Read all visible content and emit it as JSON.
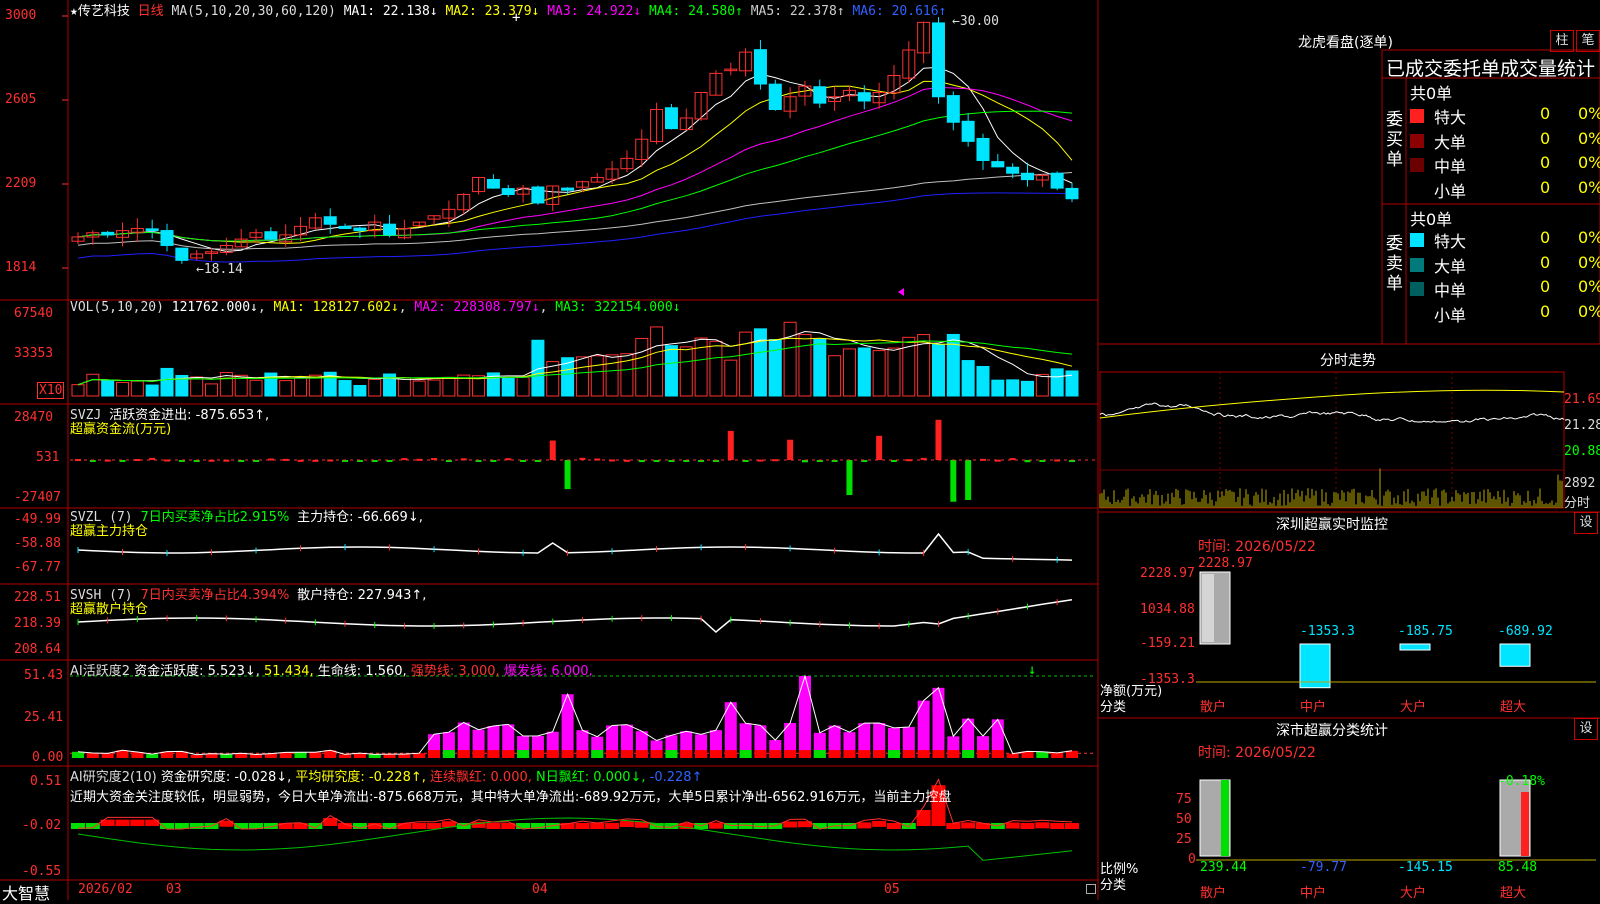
{
  "colors": {
    "up": "#ff3030",
    "down": "#00e5ff",
    "ma1": "#ffffff",
    "ma2": "#ffff00",
    "ma3": "#ff00ff",
    "ma4": "#00ff00",
    "ma5": "#c0c0c0",
    "ma6": "#2020ff",
    "frame": "#b00000"
  },
  "header": {
    "star": "★",
    "name": "传艺科技",
    "period": "日线",
    "ma_def": "MA(5,10,20,30,60,120)",
    "ma1": "MA1: 22.138↓",
    "ma2": "MA2: 23.379↓",
    "ma3": "MA3: 24.922↓",
    "ma4": "MA4: 24.580↑",
    "ma5": "MA5: 22.378↑",
    "ma6": "MA6: 20.616↑"
  },
  "price_axis": [
    "3000",
    "2605",
    "2209",
    "1814"
  ],
  "price_notes": {
    "high": "30.00",
    "low": "18.14"
  },
  "vol_panel": {
    "title": "VOL(5,10,20)",
    "v": "121762.000↓",
    "ma1": "MA1: 128127.602↓",
    "ma2": "MA2: 228308.797↓",
    "ma3": "MA3: 322154.000↓",
    "axis": [
      "67540",
      "33353"
    ],
    "unit": "X10"
  },
  "svzj": {
    "title": "SVZJ",
    "desc": "活跃资金进出: -875.653↑,",
    "sub": "超赢资金流(万元)",
    "axis": [
      "28470",
      "531",
      "-27407"
    ]
  },
  "svzl": {
    "title": "SVZL (7)",
    "desc1": "7日内买卖净占比2.915%",
    "desc2": "主力持仓: -66.669↓,",
    "sub": "超赢主力持仓",
    "axis": [
      "-49.99",
      "-58.88",
      "-67.77"
    ]
  },
  "svsh": {
    "title": "SVSH (7)",
    "desc1": "7日内买卖净占比4.394%",
    "desc2": "散户持仓: 227.943↑,",
    "sub": "超赢散户持仓",
    "axis": [
      "228.51",
      "218.39",
      "208.64"
    ]
  },
  "ai2": {
    "title": "AI活跃度2",
    "d1": "资金活跃度: 5.523↓",
    "d2": "51.434,",
    "d3": "生命线: 1.560,",
    "d4": "强势线: 3.000,",
    "d5": "爆发线: 6.000,",
    "axis": [
      "51.43",
      "25.41",
      "0.00"
    ]
  },
  "ai3": {
    "title": "AI研究度2(10)",
    "d1": "资金研究度: -0.028↓,",
    "d2": "平均研究度: -0.228↑,",
    "d3": "连续飘红: 0.000,",
    "d4": "N日飘红: 0.000↓,",
    "d5": "-0.228↑",
    "text": "近期大资金关注度较低，明显弱势，今日大单净流出:-875.668万元，其中特大单净流出:-689.92万元，大单5日累计净出-6562.916万元，当前主力控盘",
    "axis": [
      "0.51",
      "-0.02",
      "-0.55"
    ]
  },
  "date_axis": {
    "left": "大智慧",
    "labels": [
      "2026/02",
      "03",
      "04",
      "05"
    ]
  },
  "right": {
    "title": "龙虎看盘(逐单)",
    "btn1": "柱",
    "btn2": "笔",
    "subtitle": "已成交委托单成交量统计",
    "buy_label": "委买单",
    "sell_label": "委卖单",
    "buy_total": "共0单",
    "sell_total": "共0单",
    "buy_rows": [
      {
        "name": "特大",
        "n": "0",
        "p": "0%",
        "c": "#ff2020"
      },
      {
        "name": "大单",
        "n": "0",
        "p": "0%",
        "c": "#8b0000"
      },
      {
        "name": "中单",
        "n": "0",
        "p": "0%",
        "c": "#6b0000"
      },
      {
        "name": "小单",
        "n": "0",
        "p": "0%",
        "c": ""
      }
    ],
    "sell_rows": [
      {
        "name": "特大",
        "n": "0",
        "p": "0%",
        "c": "#00e5ff"
      },
      {
        "name": "大单",
        "n": "0",
        "p": "0%",
        "c": "#007a7a"
      },
      {
        "name": "中单",
        "n": "0",
        "p": "0%",
        "c": "#006060"
      },
      {
        "name": "小单",
        "n": "0",
        "p": "0%",
        "c": ""
      }
    ]
  },
  "intraday": {
    "title": "分时走势",
    "axis": [
      "21.69",
      "21.28",
      "20.88"
    ],
    "vol": "2892",
    "unit": "分时"
  },
  "monitor": {
    "title": "深圳超赢实时监控",
    "btn": "设",
    "time": "时间: 2026/05/22",
    "axis": [
      "2228.97",
      "1034.88",
      "-159.21",
      "-1353.3"
    ],
    "ylabel": "净额(万元)",
    "xlabel": "分类",
    "top_val": "2228.97",
    "vals": [
      "-1353.3",
      "-185.75",
      "-689.92"
    ],
    "cats": [
      "散户",
      "中户",
      "大户",
      "超大"
    ]
  },
  "classify": {
    "title": "深市超赢分类统计",
    "btn": "设",
    "time": "时间: 2026/05/22",
    "axis": [
      "75",
      "50",
      "25",
      "0"
    ],
    "ylabel": "比例%",
    "xlabel": "分类",
    "top_val": "-0.18%",
    "vals": [
      "239.44",
      "-79.77",
      "-145.15",
      "85.48"
    ],
    "cats": [
      "散户",
      "中户",
      "大户",
      "超大"
    ]
  }
}
